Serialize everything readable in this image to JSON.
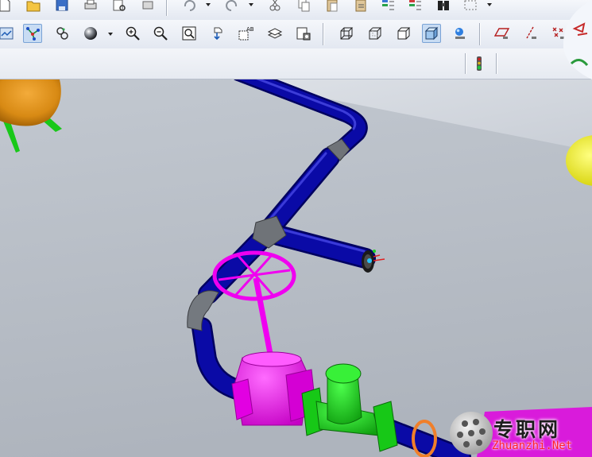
{
  "theme": {
    "pipe_color": "#0a0aa6",
    "fitting_color": "#6f7378",
    "valve_color": "#f000f0",
    "gate_color": "#19d019",
    "ground_color": "#b4bac3",
    "watermark_text_color": "#ff1e2b"
  },
  "toolbar_row1": {
    "icons": [
      "new-file-icon",
      "open-folder-icon",
      "save-icon",
      "print-icon",
      "print-preview-icon",
      "page-setup-icon",
      "undo-icon",
      "redo-icon",
      "cut-icon",
      "copy-icon",
      "paste-icon",
      "paste-special-icon",
      "regenerate-icon",
      "model-tree-icon",
      "binoculars-icon",
      "select-box-icon"
    ]
  },
  "toolbar_row2": {
    "icons": [
      "named-view-icon",
      "spin-center-icon",
      "orient-mode-icon",
      "shading-sphere-icon",
      "zoom-in-icon",
      "zoom-out-icon",
      "refit-icon",
      "reorient-icon",
      "saved-views-icon",
      "layers-icon",
      "appearance-icon",
      "wireframe-icon",
      "hidden-line-icon",
      "no-hidden-icon",
      "shaded-icon",
      "enhanced-realism-icon",
      "datum-plane-icon",
      "datum-axis-icon",
      "datum-point-icon"
    ],
    "active": [
      "spin-center-icon",
      "shaded-icon"
    ]
  },
  "toolbar_row3": {
    "icons": [
      "status-light-icon"
    ]
  },
  "watermark": {
    "chinese": "专职网",
    "english": "Zhuanzhi.Net"
  }
}
